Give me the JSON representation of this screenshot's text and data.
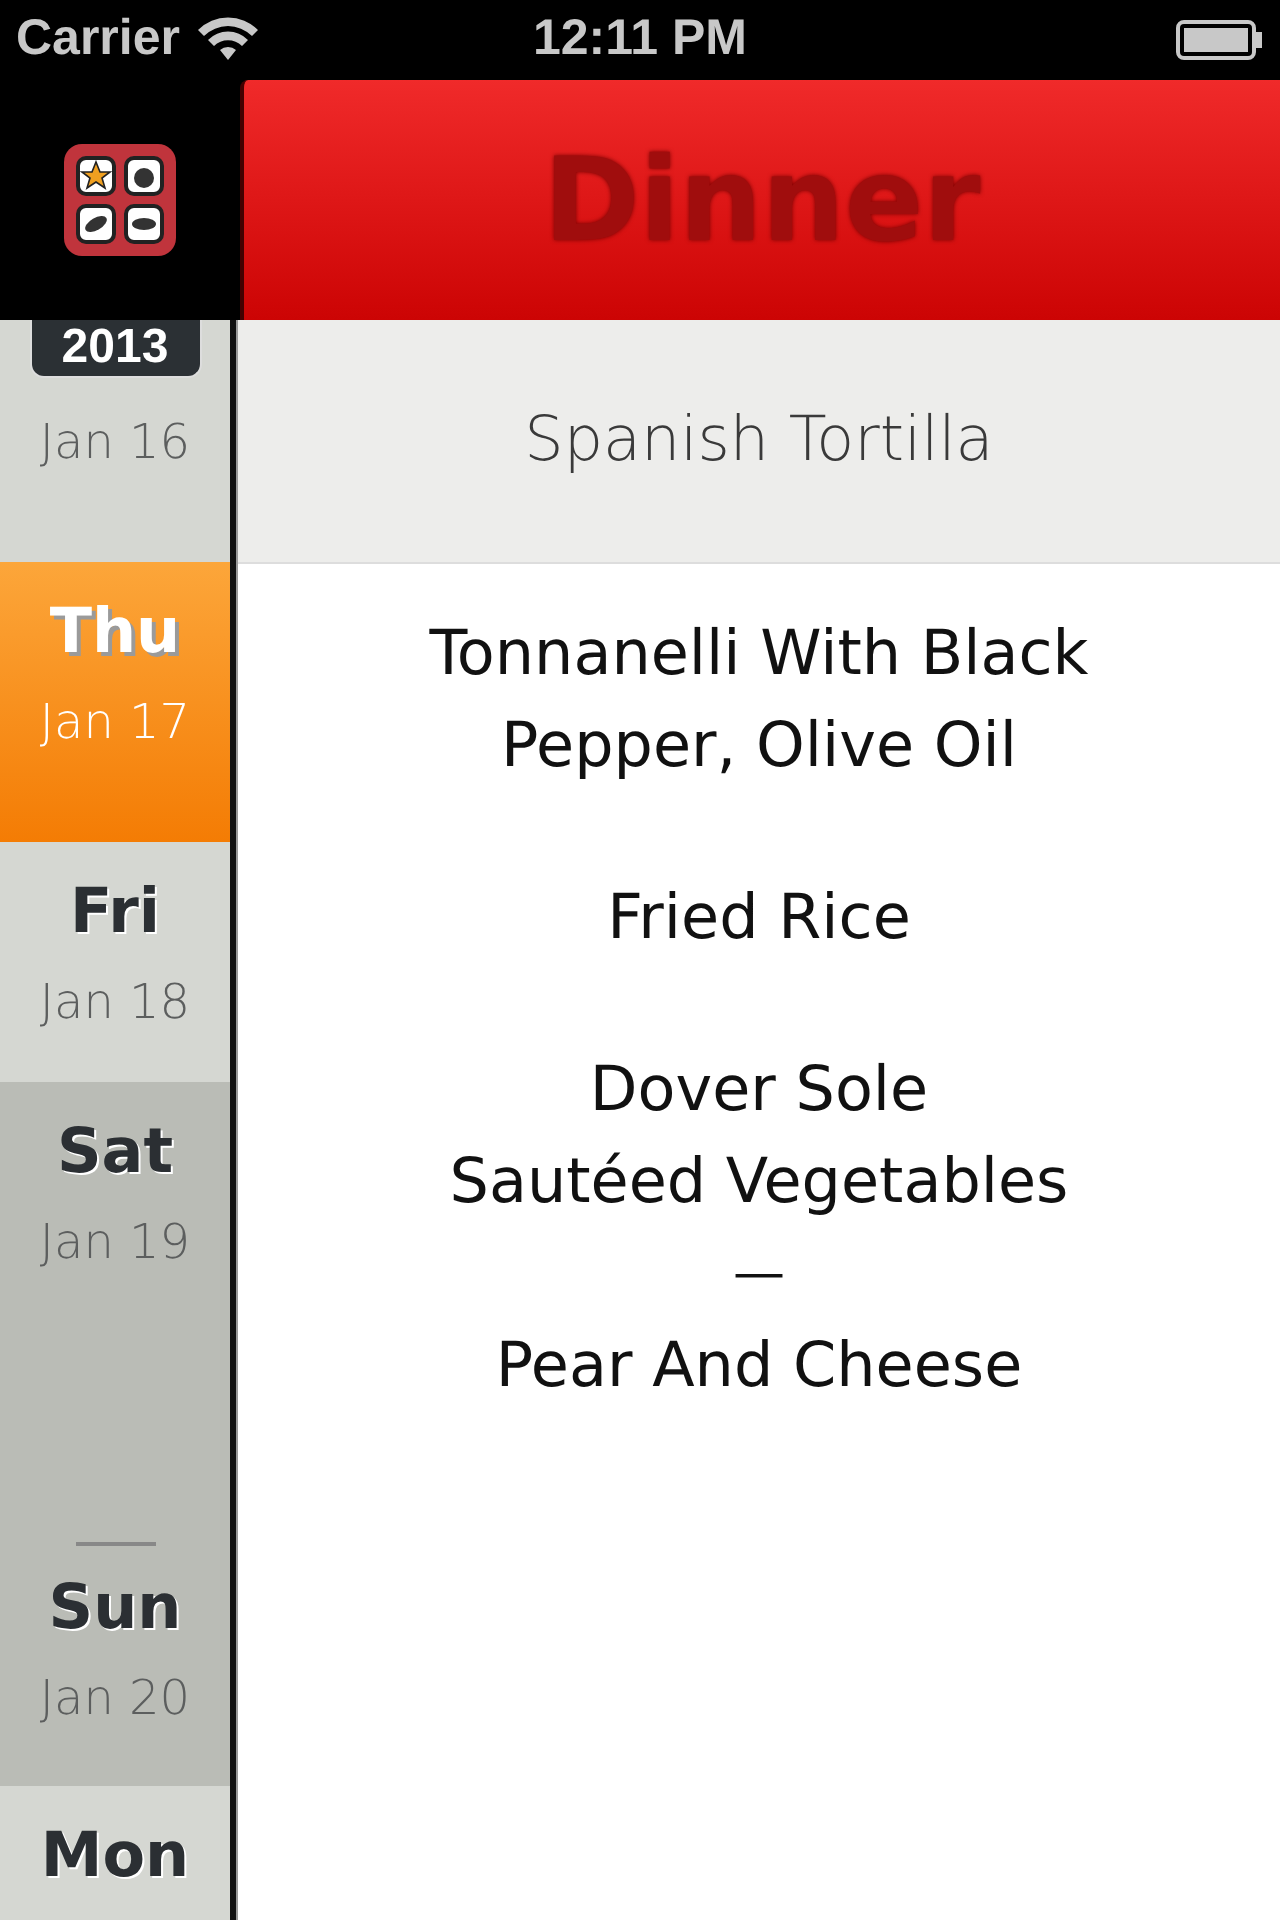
{
  "status_bar": {
    "carrier": "Carrier",
    "time": "12:11 PM"
  },
  "header": {
    "title": "Dinner"
  },
  "sidebar": {
    "year": "2013",
    "days": [
      {
        "date": "Jan 16",
        "selected": false,
        "weekend": false
      },
      {
        "day": "Thu",
        "date": "Jan 17",
        "selected": true,
        "weekend": false
      },
      {
        "day": "Fri",
        "date": "Jan 18",
        "selected": false,
        "weekend": false
      },
      {
        "day": "Sat",
        "date": "Jan 19",
        "selected": false,
        "weekend": true
      },
      {
        "day": "Sun",
        "date": "Jan 20",
        "selected": false,
        "weekend": true
      },
      {
        "day": "Mon",
        "selected": false,
        "weekend": false
      }
    ]
  },
  "menu": [
    {
      "kind": "banner",
      "text": "Spanish Tortilla"
    },
    {
      "kind": "dish",
      "text": "Tonnanelli With Black Pepper, Olive Oil"
    },
    {
      "kind": "dish",
      "text": "Fried Rice"
    },
    {
      "kind": "dish",
      "text": "Dover Sole"
    },
    {
      "kind": "dish",
      "text": "Sautéed Vegetables"
    },
    {
      "kind": "divider",
      "text": "—"
    },
    {
      "kind": "dish",
      "text": "Pear And Cheese"
    }
  ]
}
